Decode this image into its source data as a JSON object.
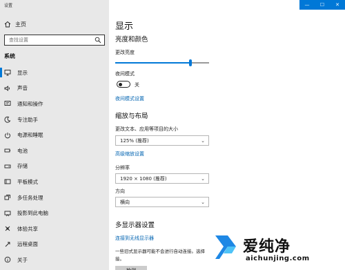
{
  "app": {
    "title": "设置"
  },
  "titlebar": {
    "minimize": "—",
    "maximize": "☐",
    "close": "✕"
  },
  "sidebar": {
    "home_label": "主页",
    "search_placeholder": "查找设置",
    "section_title": "系统",
    "items": [
      {
        "label": "显示",
        "icon": "monitor-icon",
        "active": true
      },
      {
        "label": "声音",
        "icon": "speaker-icon"
      },
      {
        "label": "通知和操作",
        "icon": "notification-icon"
      },
      {
        "label": "专注助手",
        "icon": "moon-icon"
      },
      {
        "label": "电源和睡眠",
        "icon": "power-icon"
      },
      {
        "label": "电池",
        "icon": "battery-icon"
      },
      {
        "label": "存储",
        "icon": "storage-icon"
      },
      {
        "label": "平板模式",
        "icon": "tablet-icon"
      },
      {
        "label": "多任务处理",
        "icon": "multitask-icon"
      },
      {
        "label": "投影到此电脑",
        "icon": "projector-icon"
      },
      {
        "label": "体验共享",
        "icon": "share-icon"
      },
      {
        "label": "远程桌面",
        "icon": "remote-icon"
      },
      {
        "label": "关于",
        "icon": "info-icon"
      }
    ]
  },
  "main": {
    "title": "显示",
    "brightness_heading": "亮度和颜色",
    "brightness_label": "更改亮度",
    "brightness_value": 0.8,
    "night_light_label": "夜间模式",
    "night_light_state": "关",
    "night_light_link": "夜间模式设置",
    "scale_heading": "缩放与布局",
    "scale_label": "更改文本、应用等项目的大小",
    "scale_value": "125% (推荐)",
    "advanced_scaling_link": "高级缩放设置",
    "resolution_label": "分辨率",
    "resolution_value": "1920 × 1080 (推荐)",
    "orientation_label": "方向",
    "orientation_value": "横向",
    "multi_display_heading": "多显示器设置",
    "wireless_link": "连接到无线显示器",
    "multi_display_desc": "一些旧式显示器可能不会进行自动连接。选择",
    "multi_display_desc2": "接。",
    "detect_button": "检测"
  },
  "watermark": {
    "text": "爱纯净",
    "url": "aichunjing.com"
  },
  "colors": {
    "accent": "#0078d7",
    "link": "#0063b1",
    "sidebar_bg": "#e8e8e8"
  }
}
